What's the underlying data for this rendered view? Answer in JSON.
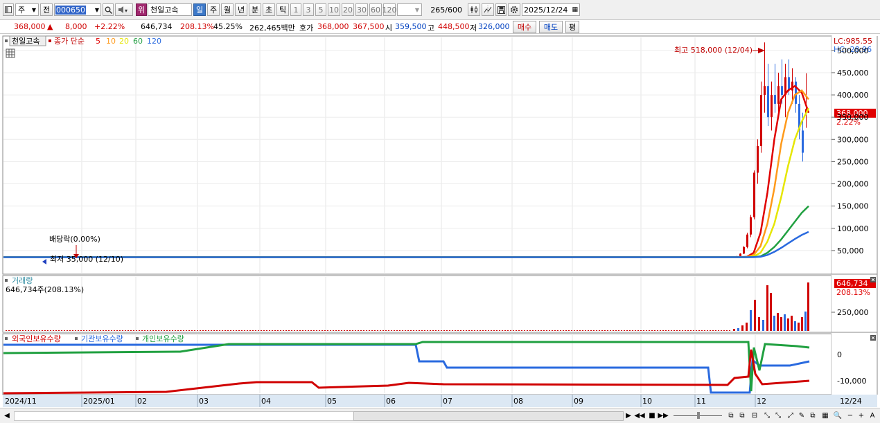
{
  "toolbar": {
    "market": "주",
    "mode": "전",
    "code": "000650",
    "badge": "위",
    "name": "천일고속",
    "periods": [
      "일",
      "주",
      "월",
      "년",
      "분",
      "초",
      "틱"
    ],
    "active_period": "일",
    "intervals": [
      "1",
      "3",
      "5",
      "10",
      "20",
      "30",
      "60",
      "120"
    ],
    "count": "265",
    "count_max": "/600",
    "date": "2025/12/24"
  },
  "quote": {
    "price": "368,000",
    "change": "8,000",
    "change_pct": "+2.22%",
    "volume": "646,734",
    "vol_ratio": "208.13%",
    "turnover_ratio": "45.25%",
    "amount": "262,465백만",
    "ask_label": "호가",
    "ask": "368,000",
    "ask2": "367,500",
    "open_label": "시",
    "open": "359,500",
    "high_label": "고",
    "high": "448,500",
    "low_label": "저",
    "low": "326,000",
    "buy": "매수",
    "sell": "매도",
    "flat": "평"
  },
  "price_panel": {
    "legend_name": "천일고속",
    "legend_ma": "종가 단순",
    "ma_periods": [
      {
        "p": "5",
        "color": "#e00000"
      },
      {
        "p": "10",
        "color": "#ff9a1a"
      },
      {
        "p": "20",
        "color": "#e6e600"
      },
      {
        "p": "60",
        "color": "#20a040"
      },
      {
        "p": "120",
        "color": "#2a6adf"
      }
    ],
    "lc": "LC:985.55",
    "hc": "HC:-28.96",
    "high_note": "최고 518,000 (12/04)",
    "low_note": "최저 35,000 (12/10)",
    "dividend_note": "배당락(0.00%)",
    "yticks": [
      "500,000",
      "450,000",
      "400,000",
      "350,000",
      "300,000",
      "250,000",
      "200,000",
      "150,000",
      "100,000",
      "50,000"
    ],
    "cur_label": "368,000",
    "cur_pct": "2.22%"
  },
  "volume_panel": {
    "title": "거래량",
    "sub": "646,734주(208.13%)",
    "cur_label": "646,734",
    "cur_pct": "208.13%",
    "ytick": "250,000"
  },
  "holding_panel": {
    "legends": [
      {
        "name": "외국인보유수량",
        "color": "#d00000"
      },
      {
        "name": "기관보유수량",
        "color": "#2a6adf"
      },
      {
        "name": "개인보유수량",
        "color": "#20a040"
      }
    ],
    "yticks": [
      "0",
      "-10,000"
    ]
  },
  "xaxis": [
    "2024/11",
    "2025/01",
    "02",
    "03",
    "04",
    "05",
    "06",
    "07",
    "08",
    "09",
    "10",
    "11",
    "12",
    "12/24"
  ],
  "chart_data": {
    "type": "line",
    "title": "천일고속",
    "series": [
      {
        "name": "MA5",
        "values": [
          35000,
          35000,
          36000,
          45000,
          90000,
          180000,
          300000,
          390000,
          410000,
          420000,
          405000,
          360000
        ]
      },
      {
        "name": "MA10",
        "values": [
          35000,
          35000,
          35500,
          40000,
          60000,
          110000,
          190000,
          290000,
          360000,
          400000,
          410000,
          390000
        ]
      },
      {
        "name": "MA20",
        "values": [
          35000,
          35000,
          35000,
          37000,
          45000,
          70000,
          110000,
          170000,
          240000,
          300000,
          340000,
          370000
        ]
      },
      {
        "name": "MA60",
        "values": [
          35000,
          35000,
          35000,
          35500,
          37000,
          45000,
          58000,
          75000,
          95000,
          115000,
          135000,
          150000
        ]
      },
      {
        "name": "MA120",
        "values": [
          35000,
          35000,
          35000,
          35000,
          36000,
          40000,
          47000,
          56000,
          66000,
          76000,
          85000,
          92000
        ]
      }
    ],
    "ylim": [
      0,
      520000
    ],
    "high": 518000,
    "low": 35000,
    "last": 368000
  }
}
